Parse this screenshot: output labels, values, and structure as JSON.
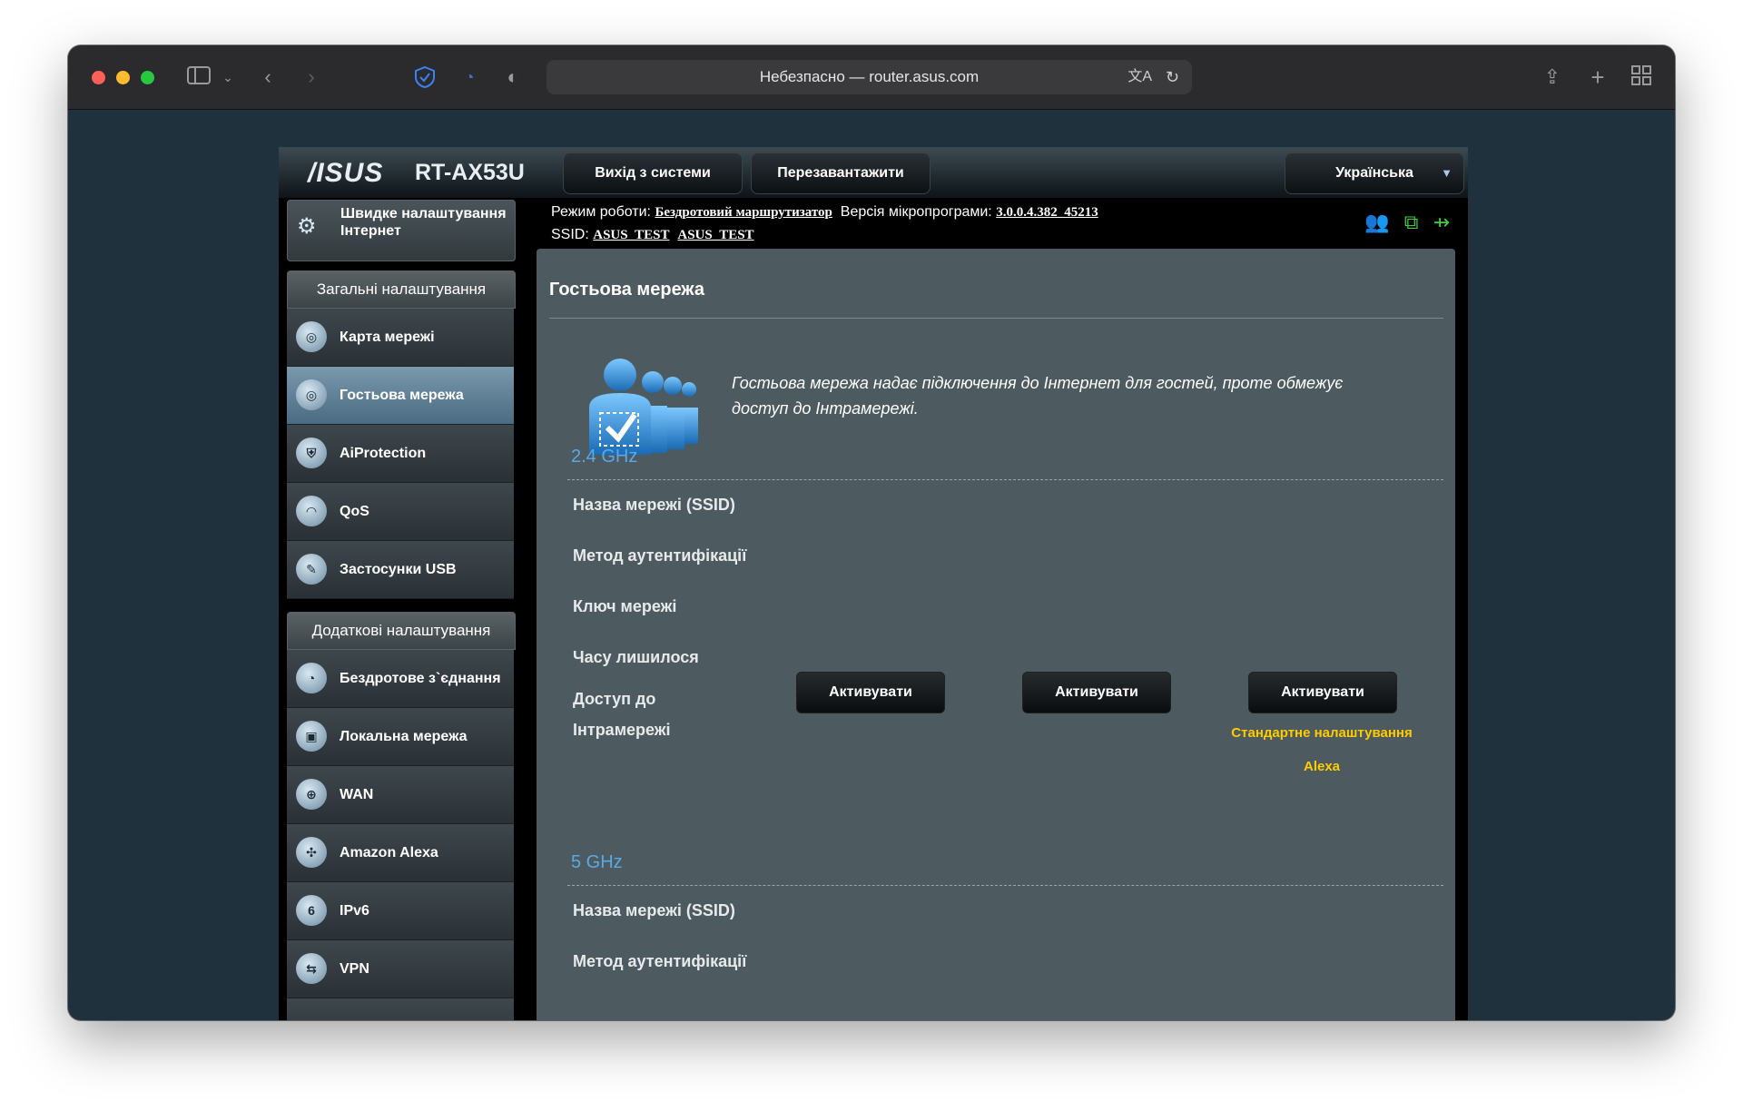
{
  "browser": {
    "address": "Небезпасно — router.asus.com",
    "icons": [
      "sidebar-icon",
      "chevron-down-icon",
      "back-icon",
      "forward-icon",
      "shield-icon",
      "rss-icon",
      "privacy-icon",
      "translate-icon",
      "reload-icon",
      "share-icon",
      "plus-icon",
      "tabs-grid-icon"
    ]
  },
  "router": {
    "brand": "/ISUS",
    "model": "RT-AX53U",
    "logout_label": "Вихід з системи",
    "reboot_label": "Перезавантажити",
    "language": "Українська",
    "mode_label": "Режим роботи:",
    "mode_value": "Бездротовий маршрутизатор",
    "firmware_label": "Версія мікропрограми:",
    "firmware_value": "3.0.0.4.382_45213",
    "ssid_label": "SSID:",
    "ssid_values": [
      "ASUS_TEST",
      "ASUS_TEST"
    ]
  },
  "sidebar": {
    "quick_setup": "Швидке налаштування Інтернет",
    "general_header": "Загальні налаштування",
    "general_items": [
      {
        "label": "Карта мережі",
        "icon": "network-map-icon"
      },
      {
        "label": "Гостьова мережа",
        "icon": "guest-network-icon",
        "active": true
      },
      {
        "label": "AiProtection",
        "icon": "aiprotection-icon"
      },
      {
        "label": "QoS",
        "icon": "qos-icon"
      },
      {
        "label": "Застосунки USB",
        "icon": "usb-apps-icon"
      }
    ],
    "advanced_header": "Додаткові налаштування",
    "advanced_items": [
      {
        "label": "Бездротове з`єднання",
        "icon": "wireless-icon"
      },
      {
        "label": "Локальна мережа",
        "icon": "lan-icon"
      },
      {
        "label": "WAN",
        "icon": "wan-icon"
      },
      {
        "label": "Amazon Alexa",
        "icon": "alexa-icon"
      },
      {
        "label": "IPv6",
        "icon": "ipv6-icon"
      },
      {
        "label": "VPN",
        "icon": "vpn-icon"
      }
    ]
  },
  "main": {
    "title": "Гостьова мережа",
    "description": "Гостьова мережа надає підключення до Інтернет для гостей, проте обмежує доступ до Інтрамережі.",
    "band_24": "2.4 GHz",
    "band_5": "5 GHz",
    "fields": [
      "Назва мережі (SSID)",
      "Метод аутентифікації",
      "Ключ мережі",
      "Часу лишилося",
      "Доступ до",
      "Інтрамережі"
    ],
    "activate_label": "Активувати",
    "default_settings": "Стандартне налаштування",
    "alexa": "Alexa"
  }
}
